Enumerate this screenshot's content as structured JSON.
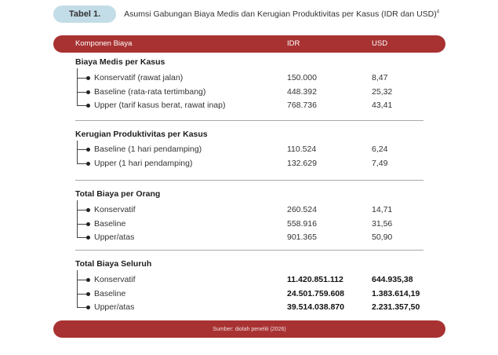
{
  "caption": {
    "label": "Tabel 1.",
    "title": "Asumsi Gabungan Biaya Medis dan Kerugian Produktivitas per Kasus (IDR dan USD)",
    "superscript": "4"
  },
  "header": {
    "col_component": "Komponen Biaya",
    "col_idr": "IDR",
    "col_usd": "USD"
  },
  "sections": [
    {
      "title": "Biaya Medis per Kasus",
      "rows": [
        {
          "label": "Konservatif (rawat jalan)",
          "idr": "150.000",
          "usd": "8,47"
        },
        {
          "label": "Baseline (rata-rata tertimbang)",
          "idr": "448.392",
          "usd": "25,32"
        },
        {
          "label": "Upper (tarif kasus berat, rawat inap)",
          "idr": "768.736",
          "usd": "43,41"
        }
      ]
    },
    {
      "title": "Kerugian Produktivitas per Kasus",
      "rows": [
        {
          "label": "Baseline (1 hari pendamping)",
          "idr": "110.524",
          "usd": "6,24"
        },
        {
          "label": "Upper (1 hari pendamping)",
          "idr": "132.629",
          "usd": "7,49"
        }
      ]
    },
    {
      "title": "Total Biaya per Orang",
      "rows": [
        {
          "label": "Konservatif",
          "idr": "260.524",
          "usd": "14,71"
        },
        {
          "label": "Baseline",
          "idr": "558.916",
          "usd": "31,56"
        },
        {
          "label": "Upper/atas",
          "idr": "901.365",
          "usd": "50,90"
        }
      ]
    },
    {
      "title": "Total Biaya Seluruh",
      "rows": [
        {
          "label": "Konservatif",
          "idr": "11.420.851.112",
          "usd": "644.935,38"
        },
        {
          "label": "Baseline",
          "idr": "24.501.759.608",
          "usd": "1.383.614,19"
        },
        {
          "label": "Upper/atas",
          "idr": "39.514.038.870",
          "usd": "2.231.357,50"
        }
      ]
    }
  ],
  "footer": {
    "source": "Sumber: diolah peneliti (2026)"
  }
}
